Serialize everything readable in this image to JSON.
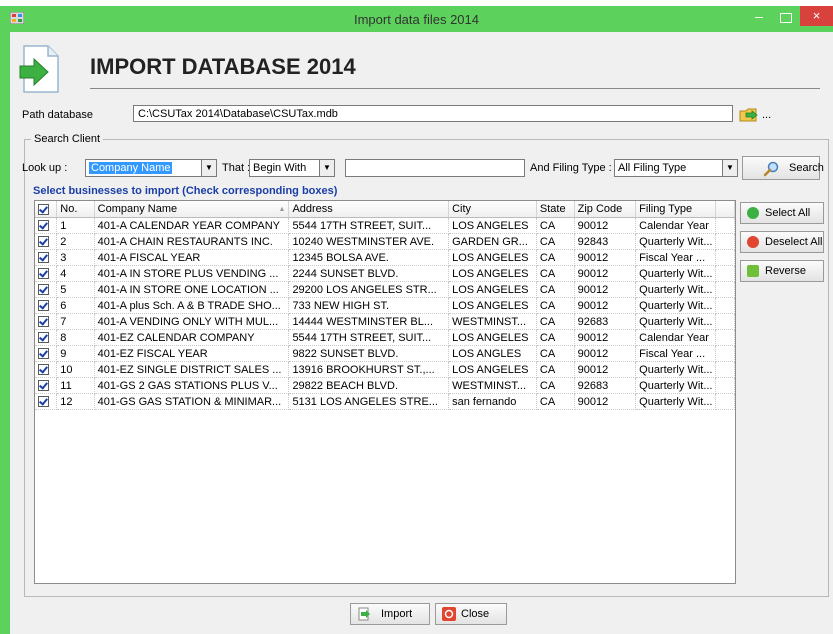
{
  "window": {
    "title": "Import data files 2014",
    "minimize_label": "–",
    "close_label": "×"
  },
  "header": {
    "title": "IMPORT DATABASE 2014"
  },
  "path": {
    "label": "Path database",
    "value": "C:\\CSUTax 2014\\Database\\CSUTax.mdb",
    "browse_label": "..."
  },
  "search": {
    "group_label": "Search Client",
    "lookup_label": "Look up :",
    "lookup_value": "Company Name",
    "that_label": "That :",
    "that_value": "Begin With",
    "text_value": "",
    "filing_label": "And Filing Type :",
    "filing_value": "All Filing Type",
    "search_button": "Search"
  },
  "list": {
    "hint": "Select businesses to import (Check corresponding boxes)",
    "columns": [
      "No.",
      "Company Name",
      "Address",
      "City",
      "State",
      "Zip Code",
      "Filing Type"
    ],
    "rows": [
      {
        "checked": true,
        "no": "1",
        "company": "401-A CALENDAR YEAR COMPANY",
        "address": "5544 17TH STREET, SUIT...",
        "city": "LOS ANGELES",
        "state": "CA",
        "zip": "90012",
        "filing": "Calendar Year"
      },
      {
        "checked": true,
        "no": "2",
        "company": "401-A CHAIN RESTAURANTS INC.",
        "address": "10240 WESTMINSTER AVE.",
        "city": "GARDEN GR...",
        "state": "CA",
        "zip": "92843",
        "filing": "Quarterly Wit..."
      },
      {
        "checked": true,
        "no": "3",
        "company": "401-A FISCAL YEAR",
        "address": "12345 BOLSA AVE.",
        "city": "LOS ANGELES",
        "state": "CA",
        "zip": "90012",
        "filing": "Fiscal Year ..."
      },
      {
        "checked": true,
        "no": "4",
        "company": "401-A IN STORE  PLUS VENDING ...",
        "address": "2244 SUNSET BLVD.",
        "city": "LOS ANGELES",
        "state": "CA",
        "zip": "90012",
        "filing": "Quarterly Wit..."
      },
      {
        "checked": true,
        "no": "5",
        "company": "401-A IN STORE ONE LOCATION ...",
        "address": "29200 LOS ANGELES STR...",
        "city": "LOS ANGELES",
        "state": "CA",
        "zip": "90012",
        "filing": "Quarterly Wit..."
      },
      {
        "checked": true,
        "no": "6",
        "company": "401-A plus Sch. A & B TRADE SHO...",
        "address": "733 NEW HIGH ST.",
        "city": "LOS ANGELES",
        "state": "CA",
        "zip": "90012",
        "filing": "Quarterly Wit..."
      },
      {
        "checked": true,
        "no": "7",
        "company": "401-A VENDING ONLY WITH MUL...",
        "address": "14444 WESTMINSTER BL...",
        "city": "WESTMINST...",
        "state": "CA",
        "zip": "92683",
        "filing": "Quarterly Wit..."
      },
      {
        "checked": true,
        "no": "8",
        "company": "401-EZ CALENDAR COMPANY",
        "address": "5544 17TH STREET, SUIT...",
        "city": "LOS ANGELES",
        "state": "CA",
        "zip": "90012",
        "filing": "Calendar Year"
      },
      {
        "checked": true,
        "no": "9",
        "company": "401-EZ FISCAL YEAR",
        "address": "9822 SUNSET BLVD.",
        "city": "LOS ANGLES",
        "state": "CA",
        "zip": "90012",
        "filing": "Fiscal Year ..."
      },
      {
        "checked": true,
        "no": "10",
        "company": "401-EZ SINGLE DISTRICT SALES ...",
        "address": "13916 BROOKHURST ST.,...",
        "city": "LOS ANGELES",
        "state": "CA",
        "zip": "90012",
        "filing": "Quarterly Wit..."
      },
      {
        "checked": true,
        "no": "11",
        "company": "401-GS 2 GAS STATIONS PLUS V...",
        "address": "29822 BEACH BLVD.",
        "city": "WESTMINST...",
        "state": "CA",
        "zip": "92683",
        "filing": "Quarterly Wit..."
      },
      {
        "checked": true,
        "no": "12",
        "company": "401-GS GAS STATION & MINIMAR...",
        "address": "5131 LOS ANGELES STRE...",
        "city": "san fernando",
        "state": "CA",
        "zip": "90012",
        "filing": "Quarterly Wit..."
      }
    ]
  },
  "side_buttons": {
    "select_all": "Select All",
    "deselect_all": "Deselect All",
    "reverse": "Reverse"
  },
  "footer": {
    "import_button": "Import",
    "close_button": "Close"
  },
  "colors": {
    "frame": "#5cd15c",
    "close_button": "#d9413d",
    "hint": "#1a3ea6",
    "selection": "#3399ff"
  }
}
